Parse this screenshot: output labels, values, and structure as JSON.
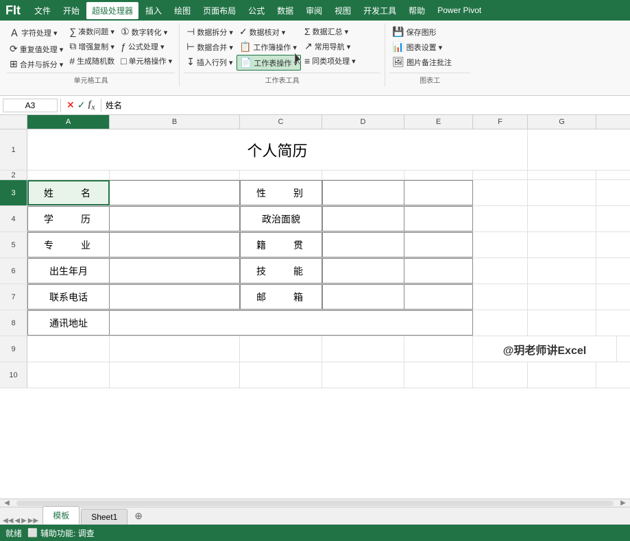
{
  "app": {
    "title": "FIt"
  },
  "menubar": {
    "items": [
      {
        "id": "file",
        "label": "文件"
      },
      {
        "id": "home",
        "label": "开始"
      },
      {
        "id": "super",
        "label": "超级处理器",
        "active": true
      },
      {
        "id": "insert",
        "label": "插入"
      },
      {
        "id": "draw",
        "label": "绘图"
      },
      {
        "id": "pagelayout",
        "label": "页面布局"
      },
      {
        "id": "formula",
        "label": "公式"
      },
      {
        "id": "data",
        "label": "数据"
      },
      {
        "id": "review",
        "label": "审阅"
      },
      {
        "id": "view",
        "label": "视图"
      },
      {
        "id": "developer",
        "label": "开发工具"
      },
      {
        "id": "help",
        "label": "帮助"
      },
      {
        "id": "powerpivot",
        "label": "Power Pivot"
      }
    ]
  },
  "ribbon": {
    "groups": [
      {
        "title": "单元格工具",
        "cols": [
          [
            {
              "label": "字符处理 ▾",
              "icon": "A"
            },
            {
              "label": "重复值处理 ▾",
              "icon": "⟳"
            },
            {
              "label": "合并与拆分 ▾",
              "icon": "⊞"
            }
          ],
          [
            {
              "label": "凑数问题 ▾",
              "icon": "∑"
            },
            {
              "label": "增强复制 ▾",
              "icon": "⧉"
            },
            {
              "label": "生成随机数",
              "icon": "#"
            }
          ],
          [
            {
              "label": "数字转化 ▾",
              "icon": "123"
            },
            {
              "label": "公式处理 ▾",
              "icon": "ƒ"
            },
            {
              "label": "单元格操作 ▾",
              "icon": "□"
            }
          ]
        ]
      },
      {
        "title": "工作表工具",
        "cols": [
          [
            {
              "label": "数据拆分 ▾",
              "icon": "⊣"
            },
            {
              "label": "数据合并 ▾",
              "icon": "⊢"
            },
            {
              "label": "插入行列 ▾",
              "icon": "↓"
            }
          ],
          [
            {
              "label": "数据核对 ▾",
              "icon": "✓"
            },
            {
              "label": "工作簿操作 ▾",
              "icon": "📋",
              "highlighted": true
            },
            {
              "label": "工作表操作 ▾",
              "icon": "📄",
              "active": true
            }
          ],
          [
            {
              "label": "数据汇总 ▾",
              "icon": "Σ"
            },
            {
              "label": "常用导航 ▾",
              "icon": "↗"
            },
            {
              "label": "同类项处理 ▾",
              "icon": "≡"
            }
          ]
        ]
      },
      {
        "title": "图表工",
        "cols": [
          [
            {
              "label": "保存图形",
              "icon": "💾"
            },
            {
              "label": "图表设置 ▾",
              "icon": "📊"
            },
            {
              "label": "图片备注批注",
              "icon": "🖼"
            }
          ]
        ]
      }
    ]
  },
  "formulabar": {
    "cell_ref": "A3",
    "formula_value": "姓名"
  },
  "columns": [
    "A",
    "B",
    "C",
    "D",
    "E",
    "F",
    "G"
  ],
  "rows": [
    {
      "num": "1",
      "type": "title"
    },
    {
      "num": "2",
      "type": "spacer"
    },
    {
      "num": "3",
      "type": "data",
      "selected": true
    },
    {
      "num": "4",
      "type": "data"
    },
    {
      "num": "5",
      "type": "data"
    },
    {
      "num": "6",
      "type": "data"
    },
    {
      "num": "7",
      "type": "data"
    },
    {
      "num": "8",
      "type": "data"
    },
    {
      "num": "9",
      "type": "data"
    },
    {
      "num": "10",
      "type": "data"
    }
  ],
  "sheet_title": "个人简历",
  "resume_rows": [
    {
      "left_label": "姓　　名",
      "left_val": "",
      "right_label": "性　　别",
      "right_val": "",
      "right_span": true
    },
    {
      "left_label": "学　　历",
      "left_val": "",
      "right_label": "政治面貌",
      "right_val": "",
      "right_span": true
    },
    {
      "left_label": "专　　业",
      "left_val": "",
      "right_label": "籍　　贯",
      "right_val": "",
      "right_span": true
    },
    {
      "left_label": "出生年月",
      "left_val": "",
      "right_label": "技　　能",
      "right_val": "",
      "right_span": true
    },
    {
      "left_label": "联系电话",
      "left_val": "",
      "right_label": "邮　　箱",
      "right_val": "",
      "right_span": true
    },
    {
      "left_label": "通讯地址",
      "left_val": "",
      "span": true
    }
  ],
  "watermark": "@玥老师讲Excel",
  "tabs": [
    {
      "id": "template",
      "label": "模板",
      "active": true
    },
    {
      "id": "sheet1",
      "label": "Sheet1"
    }
  ],
  "statusbar": {
    "status": "就绪",
    "accessibility": "辅助功能: 调查"
  }
}
